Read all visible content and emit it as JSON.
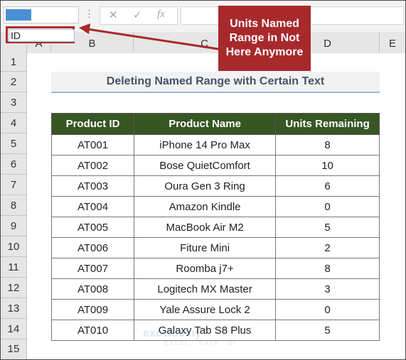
{
  "name_box": {
    "value": "ID"
  },
  "formula_bar": {
    "cancel_glyph": "✕",
    "enter_glyph": "✓",
    "fx_label": "fx"
  },
  "columns": [
    "A",
    "B",
    "C",
    "D",
    "E"
  ],
  "rows": [
    "1",
    "2",
    "3",
    "4",
    "5",
    "6",
    "7",
    "8",
    "9",
    "10",
    "11",
    "12",
    "13",
    "14",
    "15"
  ],
  "callout": {
    "text": "Units Named Range in Not Here Anymore",
    "color": "#a8292b"
  },
  "sheet_title": "Deleting Named Range with Certain Text",
  "table": {
    "headers": [
      "Product ID",
      "Product Name",
      "Units Remaining"
    ],
    "header_color": "#375623",
    "rows": [
      [
        "AT001",
        "iPhone 14 Pro Max",
        "8"
      ],
      [
        "AT002",
        "Bose QuietComfort",
        "10"
      ],
      [
        "AT003",
        "Oura Gen 3 Ring",
        "6"
      ],
      [
        "AT004",
        "Amazon Kindle",
        "0"
      ],
      [
        "AT005",
        "MacBook Air M2",
        "5"
      ],
      [
        "AT006",
        "Fiture Mini",
        "2"
      ],
      [
        "AT007",
        "Roomba j7+",
        "8"
      ],
      [
        "AT008",
        "Logitech MX Master",
        "3"
      ],
      [
        "AT009",
        "Yale Assure Lock 2",
        "0"
      ],
      [
        "AT010",
        "Galaxy Tab S8 Plus",
        "5"
      ]
    ]
  },
  "watermark": {
    "name": "exceldemy",
    "tagline": "EXCEL · DATA · BI"
  }
}
